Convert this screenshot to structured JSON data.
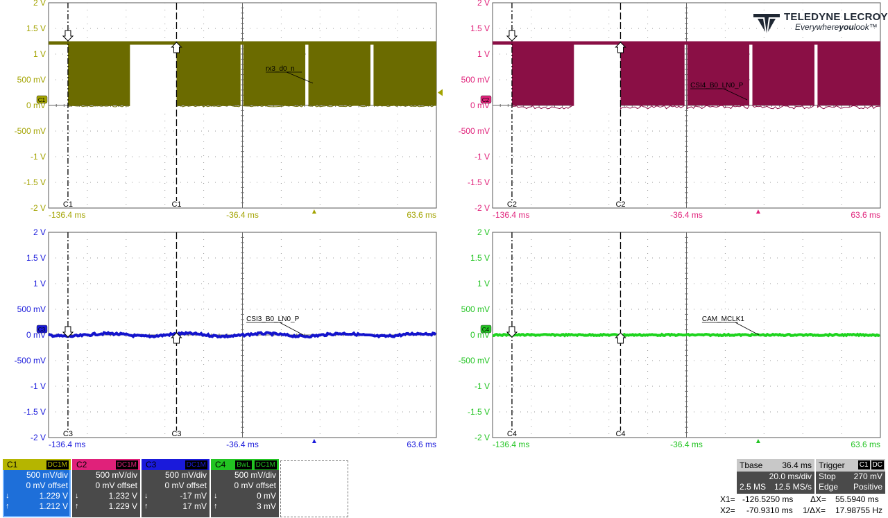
{
  "logo": {
    "brand": "TELEDYNE LECROY",
    "tagline_a": "Everywhere",
    "tagline_b": "you",
    "tagline_c": "look",
    "tm": "™"
  },
  "grids": [
    {
      "id": "g1",
      "channel": "C1",
      "color": "#7a7a00",
      "trace_color": "#6b6b00",
      "axis_color": "#a3a300",
      "y_labels": [
        "2 V",
        "1.5 V",
        "1 V",
        "500 mV",
        "0 mV",
        "-500 mV",
        "-1 V",
        "-1.5 V",
        "-2 V"
      ],
      "t_labels": [
        "-136.4 ms",
        "-36.4 ms",
        "63.6 ms"
      ],
      "cursor_labels": [
        "C1",
        "C1"
      ],
      "trace_label": "rx3_d0_n",
      "trace_kind": "burst",
      "marker_label": "C1"
    },
    {
      "id": "g2",
      "channel": "C2",
      "color": "#e0217a",
      "trace_color": "#8a0f45",
      "axis_color": "#e0217a",
      "y_labels": [
        "2 V",
        "1.5 V",
        "1 V",
        "500 mV",
        "0 mV",
        "-500 mV",
        "-1 V",
        "-1.5 V",
        "-2 V"
      ],
      "t_labels": [
        "-136.4 ms",
        "-36.4 ms",
        "63.6 ms"
      ],
      "cursor_labels": [
        "C2",
        "C2"
      ],
      "trace_label": "CSI4_B0_LN0_P",
      "trace_kind": "burst",
      "marker_label": "C2"
    },
    {
      "id": "g3",
      "channel": "C3",
      "color": "#1a1adb",
      "trace_color": "#1414cc",
      "axis_color": "#1a1adb",
      "y_labels": [
        "2 V",
        "1.5 V",
        "1 V",
        "500 mV",
        "0 mV",
        "-500 mV",
        "-1 V",
        "-1.5 V",
        "-2 V"
      ],
      "t_labels": [
        "-136.4 ms",
        "-36.4 ms",
        "63.6 ms"
      ],
      "cursor_labels": [
        "C3",
        "C3"
      ],
      "trace_label": "CSI3_B0_LN0_P",
      "trace_kind": "flat",
      "marker_label": "C3"
    },
    {
      "id": "g4",
      "channel": "C4",
      "color": "#22c422",
      "trace_color": "#1ed41e",
      "axis_color": "#22c422",
      "y_labels": [
        "2 V",
        "1.5 V",
        "1 V",
        "500 mV",
        "0 mV",
        "-500 mV",
        "-1 V",
        "-1.5 V",
        "-2 V"
      ],
      "t_labels": [
        "-136.4 ms",
        "-36.4 ms",
        "63.6 ms"
      ],
      "cursor_labels": [
        "C4",
        "C4"
      ],
      "trace_label": "CAM_MCLK1",
      "trace_kind": "flat",
      "marker_label": "C4"
    }
  ],
  "channels": [
    {
      "name": "C1",
      "color": "#b5b500",
      "tags": [
        "DC1M"
      ],
      "vdiv": "500 mV/div",
      "offset": "0 mV offset",
      "down": "1.229 V",
      "up": "1.212 V",
      "selected": true
    },
    {
      "name": "C2",
      "color": "#e0217a",
      "tags": [
        "DC1M"
      ],
      "vdiv": "500 mV/div",
      "offset": "0 mV offset",
      "down": "1.232 V",
      "up": "1.229 V",
      "selected": false
    },
    {
      "name": "C3",
      "color": "#1a1adb",
      "tags": [
        "DC1M"
      ],
      "vdiv": "500 mV/div",
      "offset": "0 mV offset",
      "down": "-17 mV",
      "up": "17 mV",
      "selected": false
    },
    {
      "name": "C4",
      "color": "#22c422",
      "tags": [
        "BwL",
        "DC1M"
      ],
      "vdiv": "500 mV/div",
      "offset": "0 mV offset",
      "down": "0 mV",
      "up": "3 mV",
      "selected": false
    }
  ],
  "tbase": {
    "label": "Tbase",
    "delay": "36.4 ms",
    "tdiv": "20.0 ms/div",
    "samples": "2.5 MS",
    "rate": "12.5 MS/s"
  },
  "trigger": {
    "label": "Trigger",
    "tags": [
      "C1",
      "DC"
    ],
    "mode": "Stop",
    "level": "270 mV",
    "type": "Edge",
    "slope": "Positive"
  },
  "cursors": {
    "x1_label": "X1=",
    "x1": "-126.5250 ms",
    "x2_label": "X2=",
    "x2": "-70.9310 ms",
    "dx_label": "ΔX=",
    "dx": "55.5940 ms",
    "inv_dx_label": "1/ΔX=",
    "inv_dx": "17.98755 Hz"
  }
}
